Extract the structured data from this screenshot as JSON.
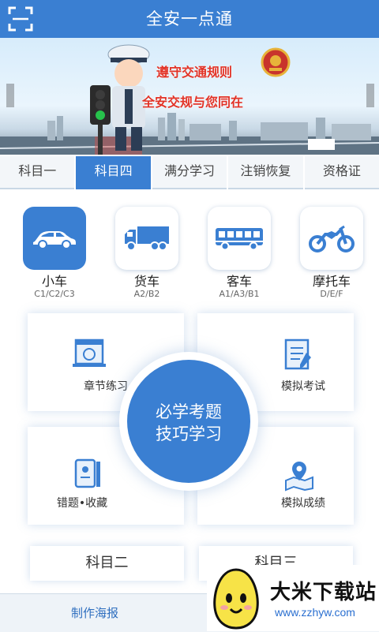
{
  "header": {
    "title": "全安一点通"
  },
  "banner": {
    "line1": "遵守交通规则",
    "line2": "全安交规与您同在"
  },
  "tabs": [
    {
      "label": "科目一",
      "active": false
    },
    {
      "label": "科目四",
      "active": true
    },
    {
      "label": "满分学习",
      "active": false
    },
    {
      "label": "注销恢复",
      "active": false
    },
    {
      "label": "资格证",
      "active": false
    }
  ],
  "vehicles": [
    {
      "label": "小车",
      "sub": "C1/C2/C3",
      "icon": "car-icon",
      "active": true
    },
    {
      "label": "货车",
      "sub": "A2/B2",
      "icon": "truck-icon",
      "active": false
    },
    {
      "label": "客车",
      "sub": "A1/A3/B1",
      "icon": "bus-icon",
      "active": false
    },
    {
      "label": "摩托车",
      "sub": "D/E/F",
      "icon": "motorcycle-icon",
      "active": false
    }
  ],
  "grid": {
    "chapter": "章节练习",
    "mock_exam": "模拟考试",
    "mistakes": "错题•收藏",
    "mock_score": "模拟成绩",
    "center_line1": "必学考题",
    "center_line2": "技巧学习"
  },
  "subjects": {
    "subject2": "科目二",
    "subject3": "科目三"
  },
  "bottom": {
    "poster": "制作海报"
  },
  "watermark": {
    "title": "大米下载站",
    "url": "www.zzhyw.com"
  },
  "colors": {
    "primary": "#3a7fd2",
    "banner_text": "#e23327"
  }
}
